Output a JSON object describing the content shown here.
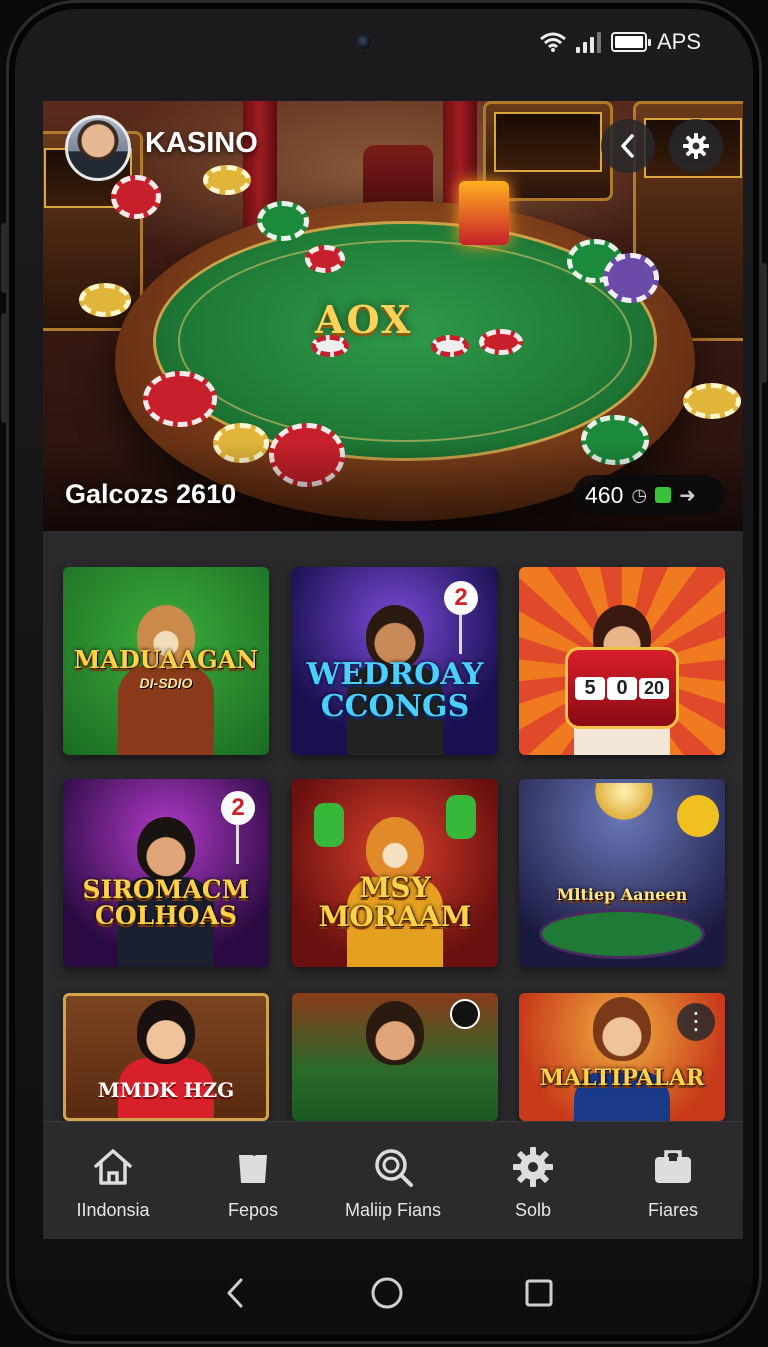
{
  "status_bar": {
    "carrier": "APS"
  },
  "header": {
    "brand": "KASINO",
    "back_icon": "chevron-left-icon",
    "settings_icon": "gear-icon"
  },
  "hero": {
    "table_text": "AOX",
    "title": "Galcozs 2610",
    "balance": "460"
  },
  "games": [
    {
      "title": "MADUAAGAN",
      "subtitle": "DI-SDIO"
    },
    {
      "title": "WEDROAY CCONGS",
      "badge": "2"
    },
    {
      "reels": [
        "5",
        "0",
        "20"
      ]
    },
    {
      "title": "SIROMACM COLHOAS",
      "badge": "2"
    },
    {
      "title": "MSY MORAAM"
    },
    {
      "title": "Mltiep Aaneen"
    },
    {
      "title": "MMDK HZG"
    },
    {
      "title": ""
    },
    {
      "title": "MALTIPALAR"
    }
  ],
  "bottom_nav": [
    {
      "label": "IIndonsia",
      "icon": "home-icon"
    },
    {
      "label": "Fepos",
      "icon": "bag-icon"
    },
    {
      "label": "Maliip Fians",
      "icon": "search-icon"
    },
    {
      "label": "Solb",
      "icon": "cog-icon"
    },
    {
      "label": "Fiares",
      "icon": "briefcase-icon"
    }
  ],
  "colors": {
    "screen_bg": "#232325",
    "nav_bg": "#2b2b2e",
    "felt": "#1f7a36",
    "gold": "#ffd24a"
  }
}
